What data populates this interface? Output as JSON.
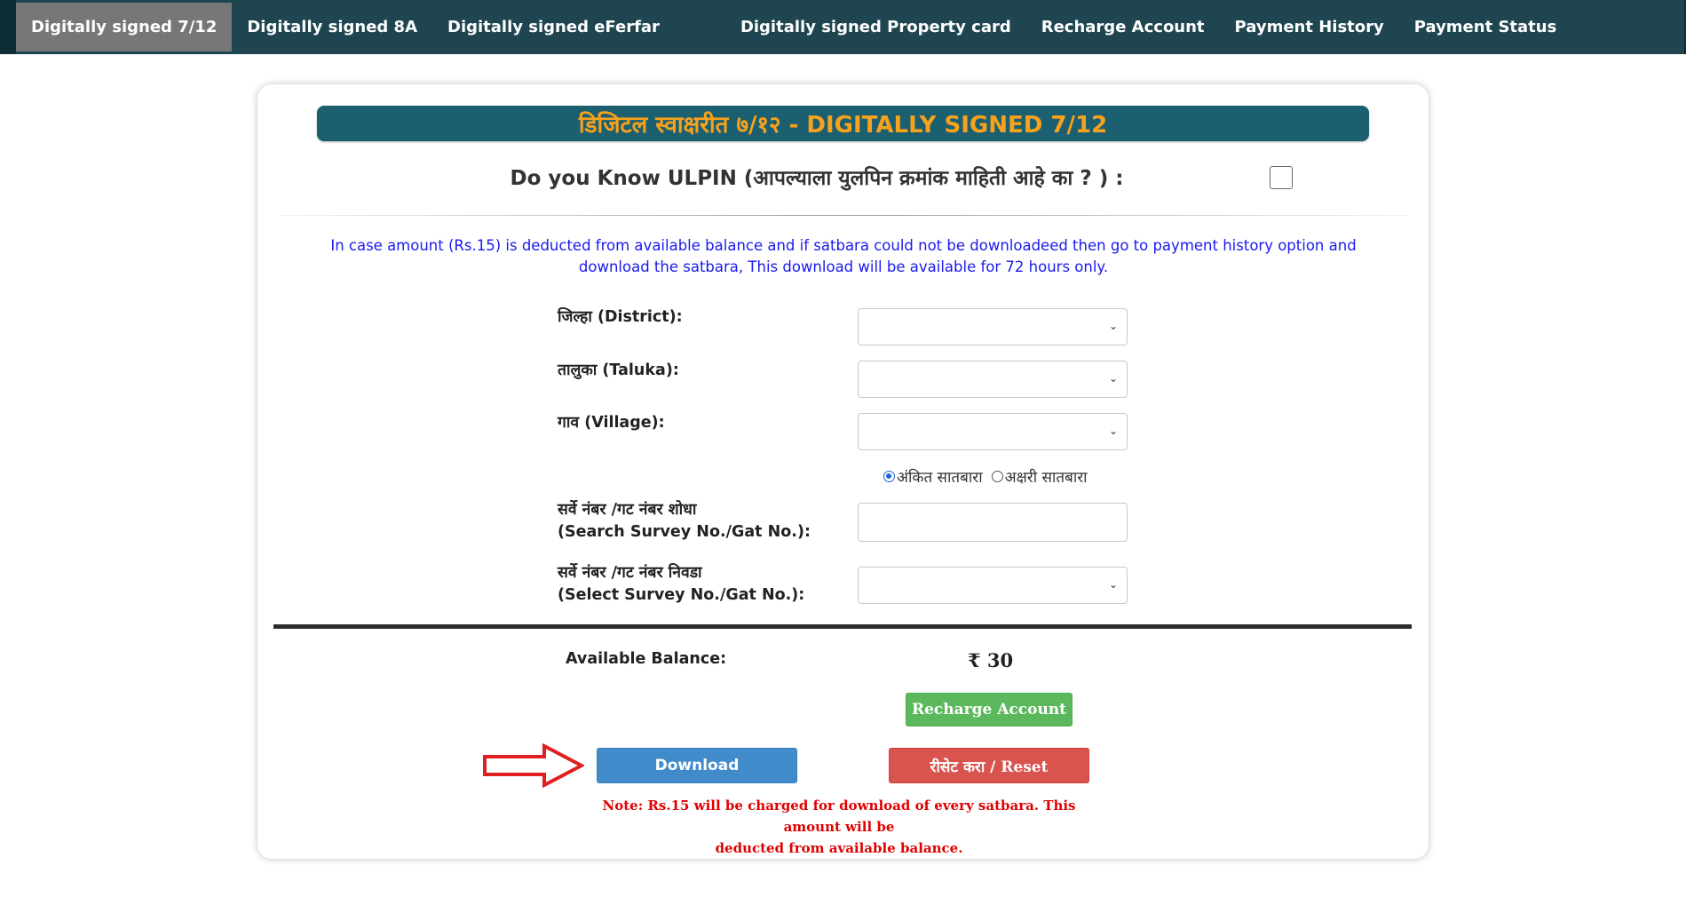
{
  "nav": {
    "items": [
      {
        "label": "Digitally signed 7/12",
        "active": true
      },
      {
        "label": "Digitally signed 8A",
        "active": false
      },
      {
        "label": "Digitally signed eFerfar",
        "active": false
      },
      {
        "label": "Digitally signed Property card",
        "active": false
      },
      {
        "label": "Recharge Account",
        "active": false
      },
      {
        "label": "Payment History",
        "active": false
      },
      {
        "label": "Payment Status",
        "active": false
      }
    ]
  },
  "form": {
    "banner": "डिजिटल स्वाक्षरीत ७/१२ - DIGITALLY SIGNED 7/12",
    "ulpin_question": "Do you Know ULPIN (आपल्याला युलपिन क्रमांक माहिती आहे का ? ) :",
    "ulpin_checked": false,
    "info_text": "In case amount (Rs.15) is deducted from available balance and if satbara could not be downloadeed then go to payment history option and download the satbara, This download will be available for 72 hours only.",
    "district_label": "जिल्हा (District):",
    "district_value": "",
    "taluka_label": "तालुका (Taluka):",
    "taluka_value": "",
    "village_label": "गाव (Village):",
    "village_value": "",
    "radio_options": [
      {
        "label": "अंकित सातबारा",
        "checked": true
      },
      {
        "label": "अक्षरी सातबारा",
        "checked": false
      }
    ],
    "search_label_mr": "सर्वे नंबर /गट नंबर शोधा",
    "search_label_en": "(Search Survey No./Gat No.):",
    "search_value": "",
    "select_label_mr": "सर्वे नंबर /गट नंबर निवडा",
    "select_label_en": "(Select Survey No./Gat No.):",
    "select_value": "",
    "balance_label": "Available Balance:",
    "balance_value": "₹ 30",
    "recharge_button": "Recharge Account",
    "download_button": "Download",
    "reset_button": "रीसेट करा / Reset",
    "note_line1": "Note: Rs.15 will be charged for download of every satbara. This amount will be",
    "note_line2": "deducted from available balance."
  },
  "colors": {
    "nav_bg": "#1f4650",
    "nav_active": "#777777",
    "banner_bg": "#1c5f70",
    "banner_text": "#f7a21c",
    "info_text": "#1a1aef",
    "note_text": "#e00000",
    "arrow": "#e02020"
  },
  "icons": {
    "dropdown": "chevron-down-icon",
    "annotation": "right-arrow-icon",
    "currency": "rupee-icon"
  }
}
